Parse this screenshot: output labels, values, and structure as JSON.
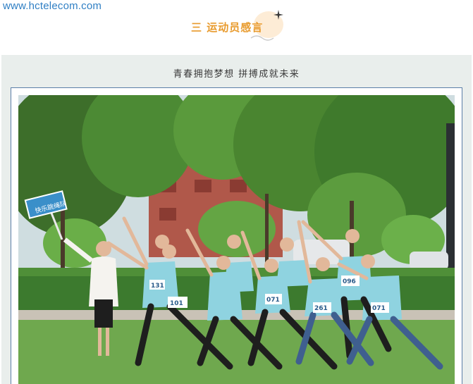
{
  "watermark": {
    "text": "www.hctelecom.com"
  },
  "section": {
    "title": "三 运动员感言",
    "accent_color": "#e89a2c"
  },
  "subtitle": "青春拥抱梦想 拼搏成就未来",
  "photo": {
    "sign_text": "快乐跳绳队",
    "bibs": [
      "131",
      "101",
      "071",
      "261",
      "096",
      "071"
    ],
    "colors": {
      "grass": "#6fa84e",
      "foliage": "#3f7a2c",
      "shirt": "#8fd3e0",
      "frame": "#5b7fa8"
    }
  }
}
